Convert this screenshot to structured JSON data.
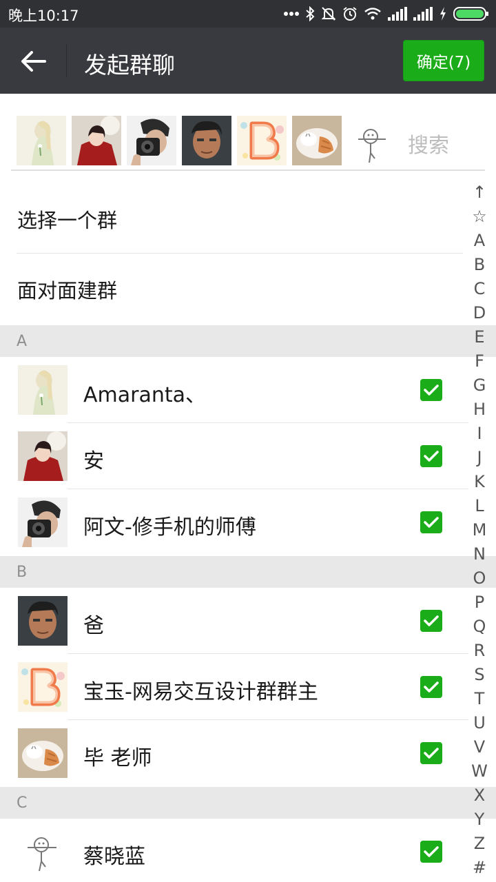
{
  "status_bar": {
    "time": "晚上10:17",
    "icons": [
      "more-dots-icon",
      "bluetooth-icon",
      "mute-bell-icon",
      "alarm-icon",
      "wifi-icon",
      "signal-icon",
      "signal-icon",
      "charging-icon",
      "battery-icon"
    ]
  },
  "header": {
    "title": "发起群聊",
    "confirm_label": "确定(7)",
    "back_icon": "back-arrow-icon"
  },
  "search": {
    "placeholder": "搜索"
  },
  "menu": {
    "select_group": "选择一个群",
    "face_to_face": "面对面建群"
  },
  "sections": [
    {
      "letter": "A",
      "contacts": [
        {
          "name": "Amaranta、",
          "checked": true
        },
        {
          "name": "安",
          "checked": true
        },
        {
          "name": "阿文-修手机的师傅",
          "checked": true
        }
      ]
    },
    {
      "letter": "B",
      "contacts": [
        {
          "name": "爸",
          "checked": true
        },
        {
          "name": "宝玉-网易交互设计群群主",
          "checked": true
        },
        {
          "name": "毕 老师",
          "checked": true
        }
      ]
    },
    {
      "letter": "C",
      "contacts": [
        {
          "name": "蔡晓蓝",
          "checked": true
        }
      ]
    }
  ],
  "index": [
    "↑",
    "☆",
    "A",
    "B",
    "C",
    "D",
    "E",
    "F",
    "G",
    "H",
    "I",
    "J",
    "K",
    "L",
    "M",
    "N",
    "O",
    "P",
    "Q",
    "R",
    "S",
    "T",
    "U",
    "V",
    "W",
    "X",
    "Y",
    "Z",
    "#"
  ],
  "colors": {
    "accent": "#1aad19",
    "title_bar": "#393a3f",
    "status_bar": "#303134",
    "section_bg": "#e8e8e8"
  }
}
